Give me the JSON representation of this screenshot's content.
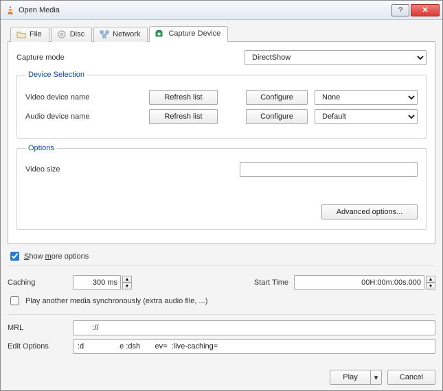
{
  "window": {
    "title": "Open Media"
  },
  "tabs": {
    "file": "File",
    "disc": "Disc",
    "network": "Network",
    "capture": "Capture Device"
  },
  "capture": {
    "mode_label": "Capture mode",
    "mode_value": "DirectShow",
    "device_selection_legend": "Device Selection",
    "video_label": "Video device name",
    "audio_label": "Audio device name",
    "refresh_label": "Refresh list",
    "configure_label": "Configure",
    "video_value": "None",
    "audio_value": "Default",
    "options_legend": "Options",
    "video_size_label": "Video size",
    "video_size_value": "",
    "advanced_label": "Advanced options..."
  },
  "more": {
    "show_label": "Show more options",
    "show_checked": true,
    "caching_label": "Caching",
    "caching_value": "300 ms",
    "start_time_label": "Start Time",
    "start_time_value": "00H:00m:00s.000",
    "sync_label": "Play another media synchronously (extra audio file, ...)",
    "sync_checked": false,
    "mrl_label": "MRL",
    "mrl_value": "       ://",
    "edit_label": "Edit Options",
    "edit_value": ":d                 e :dsh       ev=  :live-caching="
  },
  "footer": {
    "play_label": "Play",
    "cancel_label": "Cancel"
  }
}
